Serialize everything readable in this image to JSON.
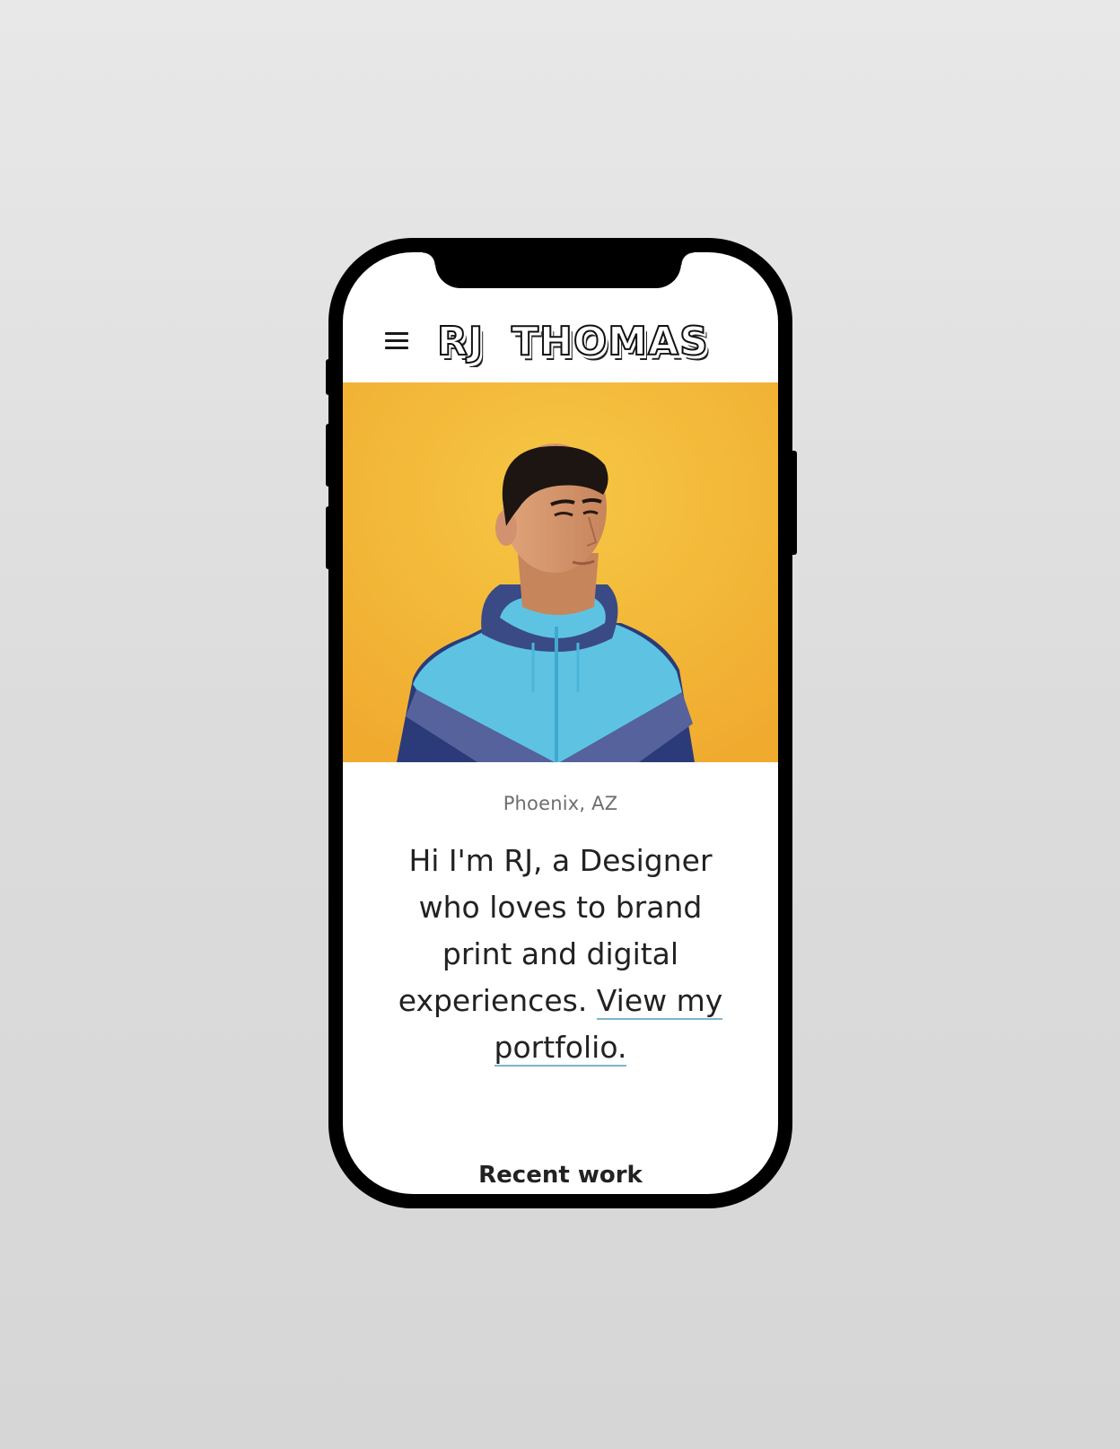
{
  "site": {
    "logo_text": "RJ THOMAS"
  },
  "nav": {
    "menu_icon": "hamburger-menu-icon"
  },
  "hero": {
    "image_alt": "Portrait of RJ against a yellow background wearing a blue windbreaker"
  },
  "intro": {
    "location": "Phoenix, AZ",
    "text": "Hi I'm RJ, a Designer who loves to brand print and digital experiences. ",
    "link_label": "View my portfolio."
  },
  "sections": {
    "recent_work_title": "Recent work"
  },
  "colors": {
    "hero_background": "#f3b735",
    "link_underline": "#7fb3d1",
    "jacket_light": "#5ec3e3",
    "jacket_dark": "#2d3c7a"
  }
}
